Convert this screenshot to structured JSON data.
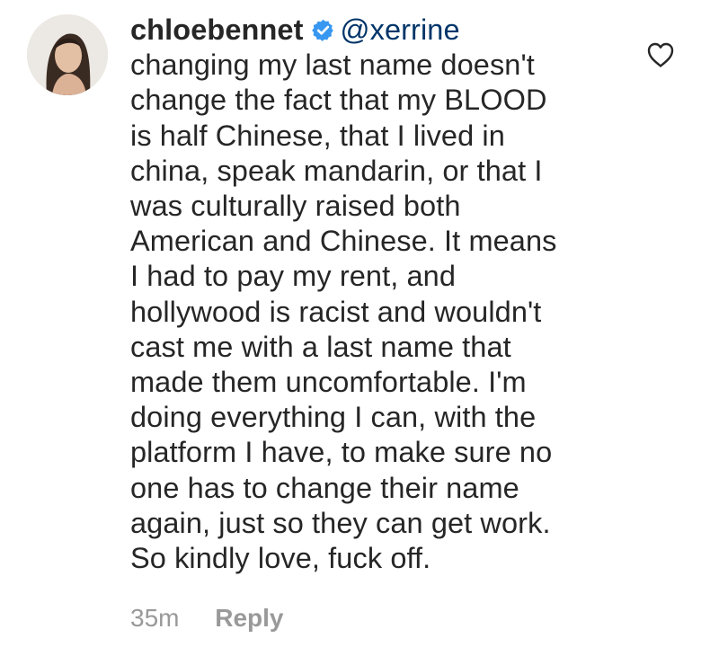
{
  "comment": {
    "username": "chloebennet",
    "verified": true,
    "mention": "@xerrine",
    "text_lines": [
      "changing my last name doesn't",
      "change the fact that my BLOOD",
      "is half Chinese, that I lived in",
      "china, speak mandarin, or that I",
      "was culturally raised both",
      "American and Chinese. It means",
      "I had to pay my rent, and",
      "hollywood is racist and wouldn't",
      "cast me with a last name that",
      "made them uncomfortable. I'm",
      "doing everything I can, with the",
      "platform I have, to make sure no",
      "one has to change their name",
      "again, just so they can get work.",
      "So kindly love, fuck off."
    ],
    "timestamp": "35m",
    "reply_label": "Reply",
    "avatar_icon": "profile-photo",
    "verified_icon": "verified-badge-icon",
    "like_icon": "heart-outline-icon"
  },
  "colors": {
    "text": "#262626",
    "meta": "#999999",
    "verified_blue": "#3897f0",
    "background": "#ffffff"
  }
}
